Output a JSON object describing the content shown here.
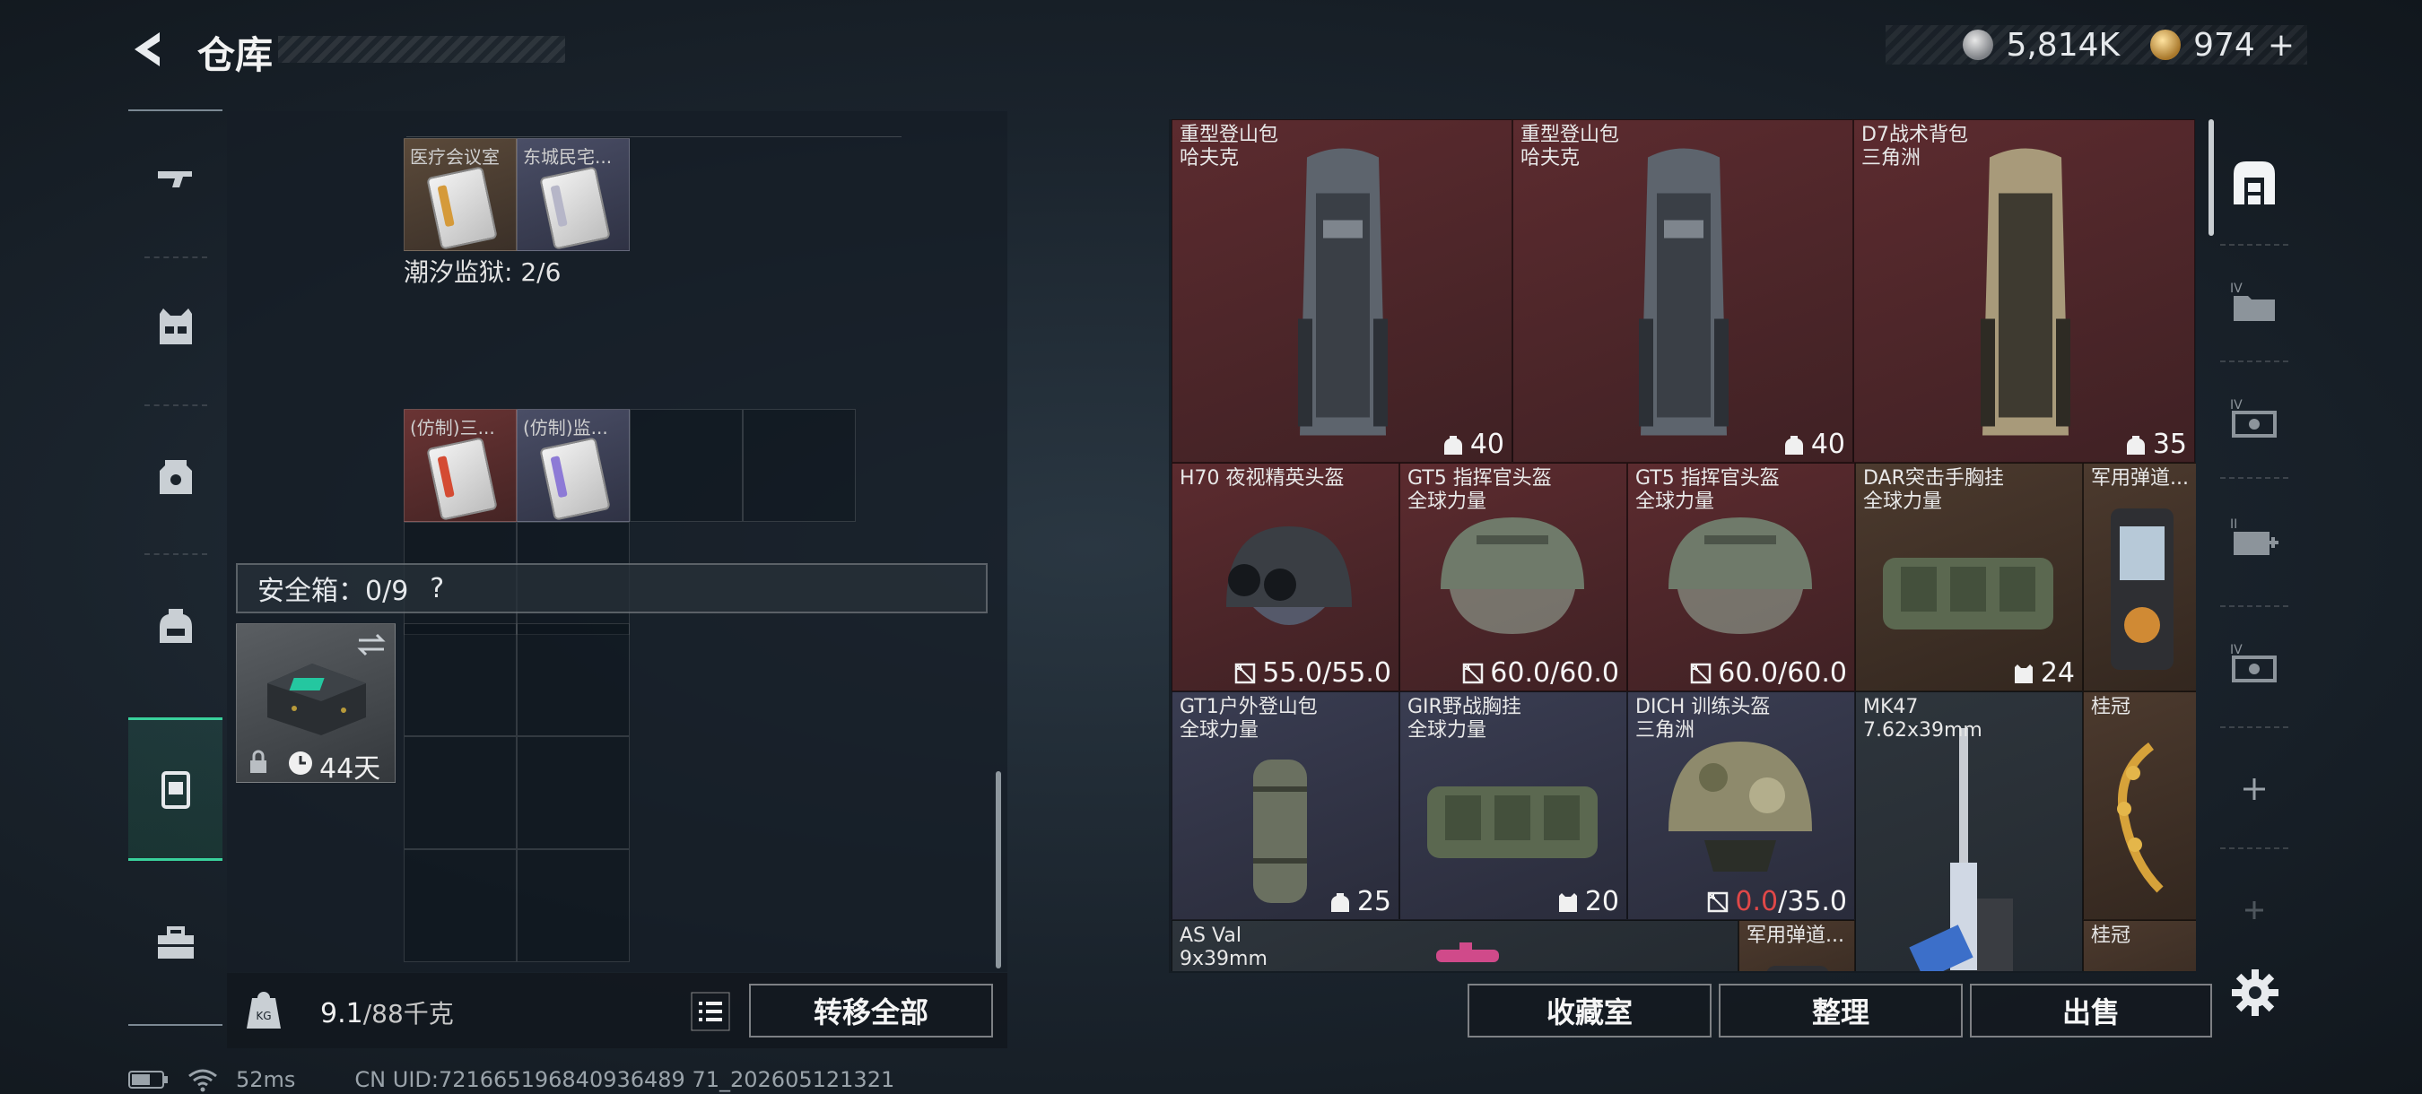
{
  "header": {
    "title": "仓库",
    "silver": "5,814K",
    "gold": "974",
    "gold_add": "+"
  },
  "left": {
    "top_items": [
      {
        "label": "医疗会议室",
        "color": "#d59a3a"
      },
      {
        "label": "东城民宅...",
        "color": "#b6b6c8"
      }
    ],
    "prison_label": "潮汐监狱: 2/6",
    "prison_items": [
      {
        "label": "(仿制)三...",
        "color": "#d44b33"
      },
      {
        "label": "(仿制)监...",
        "color": "#8d7ad6"
      }
    ],
    "safebox": {
      "label": "安全箱：0/9",
      "help": "?",
      "days": "44天"
    },
    "weight": {
      "current": "9.1",
      "max": "/88千克"
    },
    "transfer_all": "转移全部"
  },
  "stash_items": [
    {
      "name": "重型登山包\n哈夫克",
      "value": "40",
      "icon": "backpack-icon",
      "bg": "red",
      "art": "backpack-gray"
    },
    {
      "name": "重型登山包\n哈夫克",
      "value": "40",
      "icon": "backpack-icon",
      "bg": "red",
      "art": "backpack-gray"
    },
    {
      "name": "D7战术背包\n三角洲",
      "value": "35",
      "icon": "backpack-icon",
      "bg": "red",
      "art": "backpack-tan"
    },
    {
      "name": "H70 夜视精英头盔",
      "value": "55.0/55.0",
      "icon": "broken-armor-icon",
      "bg": "red",
      "art": "helmet-nv"
    },
    {
      "name": "GT5 指挥官头盔\n全球力量",
      "value": "60.0/60.0",
      "icon": "broken-armor-icon",
      "bg": "red",
      "art": "helmet-green"
    },
    {
      "name": "GT5 指挥官头盔\n全球力量",
      "value": "60.0/60.0",
      "icon": "broken-armor-icon",
      "bg": "red",
      "art": "helmet-green"
    },
    {
      "name": "DAR突击手胸挂\n全球力量",
      "value": "24",
      "icon": "vest-icon",
      "bg": "brown",
      "art": "rig-green"
    },
    {
      "name": "军用弹道...",
      "value": "",
      "icon": "",
      "bg": "brown",
      "art": "device"
    },
    {
      "name": "GT1户外登山包\n全球力量",
      "value": "25",
      "icon": "backpack-icon",
      "bg": "blue",
      "art": "backpack-roll"
    },
    {
      "name": "GIR野战胸挂\n全球力量",
      "value": "20",
      "icon": "vest-icon",
      "bg": "blue",
      "art": "rig-green"
    },
    {
      "name": "DICH 训练头盔\n三角洲",
      "value_low": "0.0",
      "value_rest": "/35.0",
      "icon": "broken-armor-icon",
      "bg": "blue",
      "art": "helmet-camo"
    },
    {
      "name": "MK47\n7.62x39mm",
      "value": "",
      "icon": "",
      "bg": "dark",
      "art": "rifle"
    },
    {
      "name": "桂冠",
      "value": "",
      "icon": "",
      "bg": "brown",
      "art": "laurel"
    },
    {
      "name": "AS Val\n9x39mm",
      "value": "",
      "icon": "",
      "bg": "dark",
      "art": "scope"
    },
    {
      "name": "军用弹道...",
      "value": "",
      "icon": "",
      "bg": "brown",
      "art": "device"
    },
    {
      "name": "桂冠",
      "value": "",
      "icon": "",
      "bg": "brown",
      "art": "laurel"
    }
  ],
  "buttons": {
    "collection": "收藏室",
    "organize": "整理",
    "sell": "出售"
  },
  "status": {
    "ping": "52ms",
    "uid": "CN UID:721665196840936489 71_202605121321"
  },
  "colors": {
    "accent": "#39d19c",
    "low_value": "#e04848"
  }
}
